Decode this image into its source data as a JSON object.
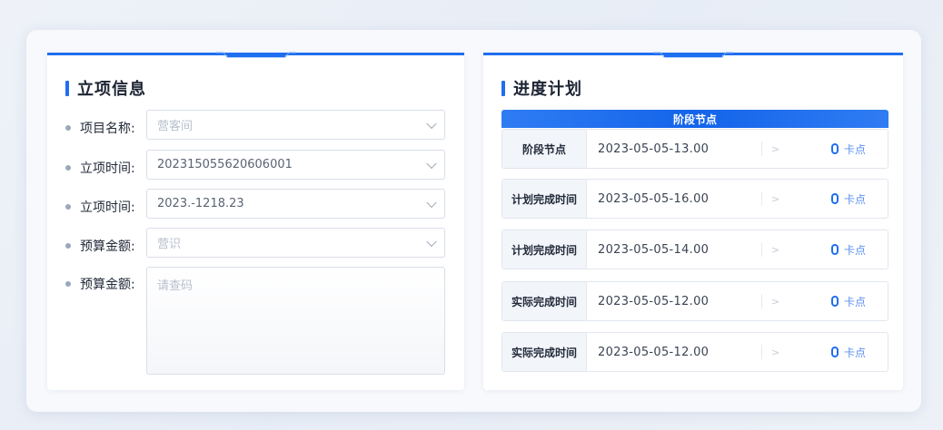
{
  "left_panel": {
    "title": "立项信息",
    "fields": [
      {
        "label": "项目名称:",
        "value": "",
        "placeholder": "营客间"
      },
      {
        "label": "立项时间:",
        "value": "202315055620606001",
        "placeholder": ""
      },
      {
        "label": "立项时间:",
        "value": "2023.-1218.23",
        "placeholder": ""
      },
      {
        "label": "预算金额:",
        "value": "",
        "placeholder": "营识"
      },
      {
        "label": "预算金额:",
        "value": "",
        "placeholder": "请查码"
      }
    ]
  },
  "right_panel": {
    "title": "进度计划",
    "table_header": "阶段节点",
    "rows": [
      {
        "label": "阶段节点",
        "value": "2023-05-05-13.00",
        "arrow": ">",
        "action": "卡点"
      },
      {
        "label": "计划完成时间",
        "value": "2023-05-05-16.00",
        "arrow": ">",
        "action": "卡点"
      },
      {
        "label": "计划完成时间",
        "value": "2023-05-05-14.00",
        "arrow": ">",
        "action": "卡点"
      },
      {
        "label": "实际完成时间",
        "value": "2023-05-05-12.00",
        "arrow": ">",
        "action": "卡点"
      },
      {
        "label": "实际完成时间",
        "value": "2023-05-05-12.00",
        "arrow": ">",
        "action": "卡点"
      }
    ]
  },
  "colors": {
    "accent": "#1f6ef0",
    "header_blue": "#1464ea"
  }
}
